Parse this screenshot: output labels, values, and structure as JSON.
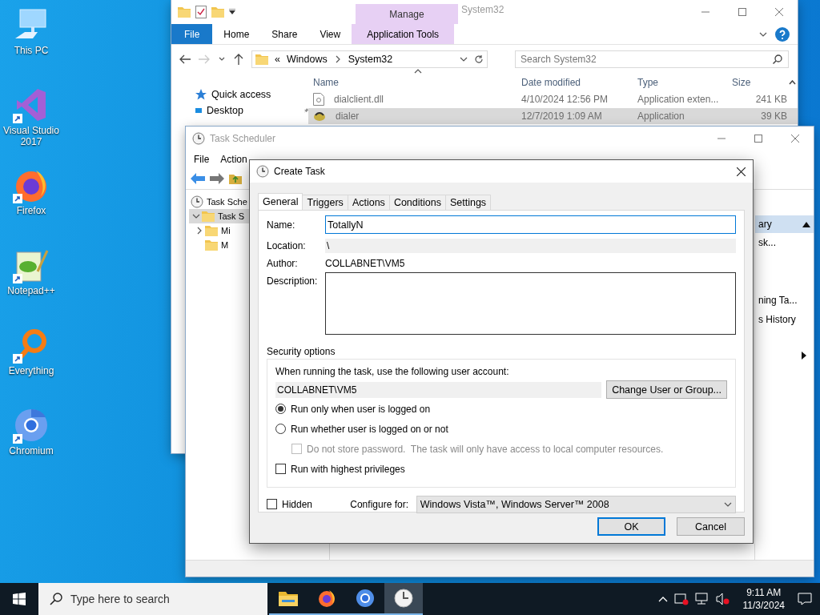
{
  "desktop_icons": [
    {
      "label": "This PC",
      "kind": "pc",
      "shortcut": false
    },
    {
      "label": "Visual Studio 2017",
      "kind": "vs",
      "shortcut": true
    },
    {
      "label": "Firefox",
      "kind": "firefox",
      "shortcut": true
    },
    {
      "label": "Notepad++",
      "kind": "notepad",
      "shortcut": true
    },
    {
      "label": "Everything",
      "kind": "everything",
      "shortcut": true
    },
    {
      "label": "Chromium",
      "kind": "chromium",
      "shortcut": true
    }
  ],
  "explorer": {
    "title": "System32",
    "context_group": "Manage",
    "ribbon_tabs": [
      {
        "label": "File",
        "kind": "file"
      },
      {
        "label": "Home",
        "kind": "tab"
      },
      {
        "label": "Share",
        "kind": "tab"
      },
      {
        "label": "View",
        "kind": "tab"
      },
      {
        "label": "Application Tools",
        "kind": "context"
      }
    ],
    "forward_disabled": true,
    "path_prefix": "«",
    "path": [
      "Windows",
      "System32"
    ],
    "search": {
      "placeholder": "Search System32"
    },
    "nav": [
      {
        "label": "Quick access",
        "kind": "star",
        "pinned": false
      },
      {
        "label": "Desktop",
        "kind": "desktop",
        "pinned": true
      }
    ],
    "columns": [
      "Name",
      "Date modified",
      "Type",
      "Size"
    ],
    "rows": [
      {
        "name": "dialclient.dll",
        "kind": "dll",
        "date": "4/10/2024 12:56 PM",
        "type": "Application exten...",
        "size": "241 KB",
        "selected": false
      },
      {
        "name": "dialer",
        "kind": "app",
        "date": "12/7/2019 1:09 AM",
        "type": "Application",
        "size": "39 KB",
        "selected": true
      }
    ]
  },
  "task_scheduler": {
    "title": "Task Scheduler",
    "menu": [
      "File",
      "Action"
    ],
    "tree": [
      {
        "label": "Task Sche",
        "selected": false,
        "children": [
          {
            "label": "Task S",
            "expanded": true,
            "selected": true,
            "children": [
              {
                "label": "Mi",
                "expanded": false,
                "selected": false
              },
              {
                "label": "M",
                "selected": false
              }
            ]
          }
        ]
      }
    ],
    "actions": {
      "header": "ary",
      "items": [
        "sk...",
        "ning Ta...",
        "s History"
      ]
    }
  },
  "create_task": {
    "title": "Create Task",
    "tabs": [
      {
        "label": "General",
        "selected": true
      },
      {
        "label": "Triggers",
        "selected": false
      },
      {
        "label": "Actions",
        "selected": false
      },
      {
        "label": "Conditions",
        "selected": false
      },
      {
        "label": "Settings",
        "selected": false
      }
    ],
    "name": {
      "label": "Name:",
      "value": "TotallyN",
      "focused": true
    },
    "location": {
      "label": "Location:",
      "value": "\\"
    },
    "author": {
      "label": "Author:",
      "value": "COLLABNET\\VM5"
    },
    "description": {
      "label": "Description:"
    },
    "security": {
      "title": "Security options",
      "prompt": "When running the task, use the following user account:",
      "account": "COLLABNET\\VM5",
      "change_button": "Change User or Group...",
      "radios": [
        {
          "label": "Run only when user is logged on",
          "selected": true
        },
        {
          "label": "Run whether user is logged on or not",
          "selected": false
        }
      ],
      "do_not_store": {
        "label": "Do not store password.  The task will only have access to local computer resources.",
        "checked": false,
        "disabled": true
      },
      "highest": {
        "label": "Run with highest privileges",
        "checked": false,
        "disabled": false
      }
    },
    "hidden": {
      "label": "Hidden",
      "checked": false
    },
    "configure": {
      "label": "Configure for:",
      "value": "Windows Vista™, Windows Server™ 2008"
    },
    "buttons": [
      {
        "label": "OK",
        "default": true
      },
      {
        "label": "Cancel",
        "default": false
      }
    ]
  },
  "taskbar": {
    "search": {
      "placeholder": "Type here to search"
    },
    "apps": [
      {
        "kind": "explorer",
        "running": true,
        "active": false
      },
      {
        "kind": "firefox",
        "running": true,
        "active": false
      },
      {
        "kind": "chromium",
        "running": true,
        "active": false
      },
      {
        "kind": "scheduler",
        "running": true,
        "active": true
      }
    ],
    "time": "9:11 AM",
    "date": "11/3/2024"
  }
}
